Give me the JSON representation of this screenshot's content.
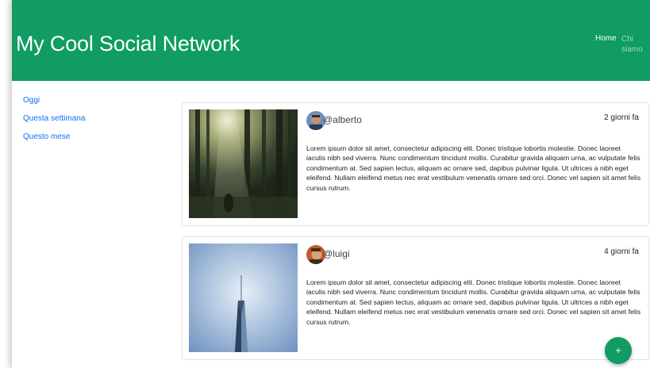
{
  "navbar": {
    "brand": "My Cool Social Network",
    "links": [
      "Home",
      "Chi siamo"
    ]
  },
  "sidebar": {
    "items": [
      {
        "label": "Oggi"
      },
      {
        "label": "Questa settimana"
      },
      {
        "label": "Questo mese"
      }
    ]
  },
  "posts": [
    {
      "username": "@alberto",
      "time": "2 giorni fa",
      "text": "Lorem ipsum dolor sit amet, consectetur adipiscing elit. Donec tristique lobortis molestie. Donec laoreet iaculis nibh sed viverra. Nunc condimentum tincidunt mollis. Curabitur gravida aliquam urna, ac vulputate felis condimentum at. Sed sapien lectus, aliquam ac ornare sed, dapibus pulvinar ligula. Ut ultrices a nibh eget eleifend. Nullam eleifend metus nec erat vestibulum venenatis ornare sed orci. Donec vel sapien sit amet felis cursus rutrum.",
      "image_icon": "forest-photo",
      "avatar_icon": "user-avatar"
    },
    {
      "username": "@luigi",
      "time": "4 giorni fa",
      "text": "Lorem ipsum dolor sit amet, consectetur adipiscing elit. Donec tristique lobortis molestie. Donec laoreet iaculis nibh sed viverra. Nunc condimentum tincidunt mollis. Curabitur gravida aliquam urna, ac vulputate felis condimentum at. Sed sapien lectus, aliquam ac ornare sed, dapibus pulvinar ligula. Ut ultrices a nibh eget eleifend. Nullam eleifend metus nec erat vestibulum venenatis ornare sed orci. Donec vel sapien sit amet felis cursus rutrum.",
      "image_icon": "skyscraper-photo",
      "avatar_icon": "user-avatar"
    }
  ],
  "fab": {
    "label": "+"
  },
  "colors": {
    "brand": "#109c62",
    "link": "#0d6efd"
  }
}
